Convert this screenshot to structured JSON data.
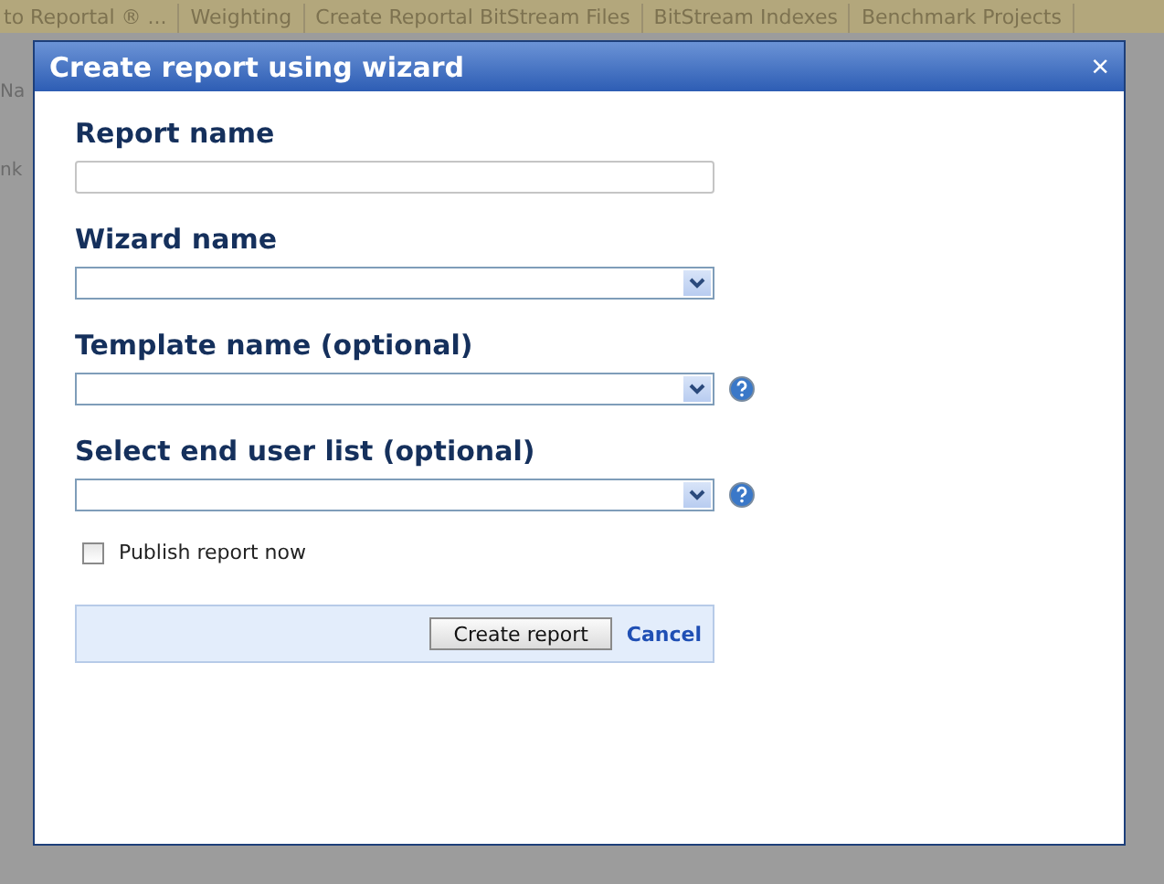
{
  "background": {
    "tabs": [
      "to Reportal ® ...",
      "Weighting",
      "Create Reportal BitStream Files",
      "BitStream Indexes",
      "Benchmark Projects"
    ],
    "fragments": [
      "Na",
      "nk"
    ]
  },
  "dialog": {
    "title": "Create report using wizard",
    "close": "×",
    "fields": [
      {
        "label": "Report name",
        "kind": "text",
        "help": false
      },
      {
        "label": "Wizard name",
        "kind": "select",
        "help": false
      },
      {
        "label": "Template name (optional)",
        "kind": "select",
        "help": true
      },
      {
        "label": "Select end user list (optional)",
        "kind": "select",
        "help": true
      }
    ],
    "publish": {
      "label": "Publish report now",
      "checked": false
    },
    "buttons": {
      "create": "Create report",
      "cancel": "Cancel"
    }
  }
}
